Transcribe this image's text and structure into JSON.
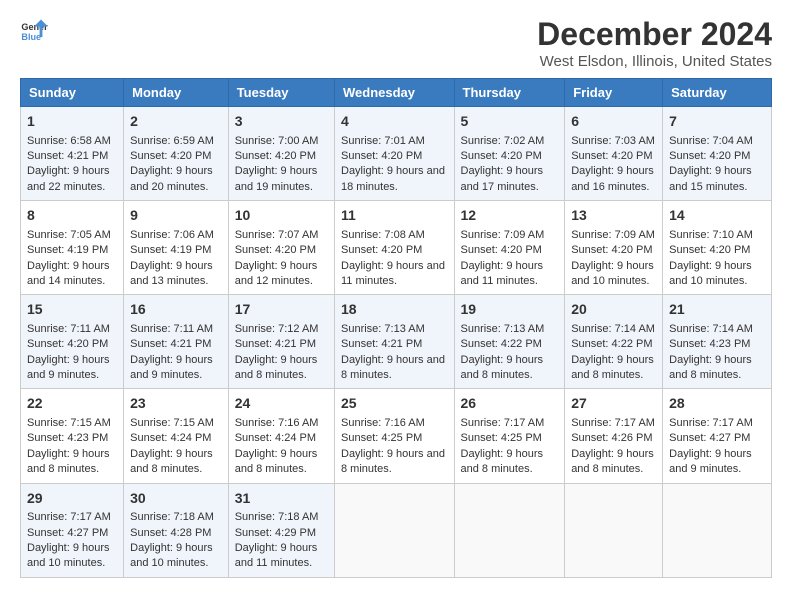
{
  "logo": {
    "line1": "General",
    "line2": "Blue"
  },
  "title": "December 2024",
  "subtitle": "West Elsdon, Illinois, United States",
  "days_of_week": [
    "Sunday",
    "Monday",
    "Tuesday",
    "Wednesday",
    "Thursday",
    "Friday",
    "Saturday"
  ],
  "weeks": [
    [
      {
        "day": "1",
        "sunrise": "6:58 AM",
        "sunset": "4:21 PM",
        "daylight": "9 hours and 22 minutes."
      },
      {
        "day": "2",
        "sunrise": "6:59 AM",
        "sunset": "4:20 PM",
        "daylight": "9 hours and 20 minutes."
      },
      {
        "day": "3",
        "sunrise": "7:00 AM",
        "sunset": "4:20 PM",
        "daylight": "9 hours and 19 minutes."
      },
      {
        "day": "4",
        "sunrise": "7:01 AM",
        "sunset": "4:20 PM",
        "daylight": "9 hours and 18 minutes."
      },
      {
        "day": "5",
        "sunrise": "7:02 AM",
        "sunset": "4:20 PM",
        "daylight": "9 hours and 17 minutes."
      },
      {
        "day": "6",
        "sunrise": "7:03 AM",
        "sunset": "4:20 PM",
        "daylight": "9 hours and 16 minutes."
      },
      {
        "day": "7",
        "sunrise": "7:04 AM",
        "sunset": "4:20 PM",
        "daylight": "9 hours and 15 minutes."
      }
    ],
    [
      {
        "day": "8",
        "sunrise": "7:05 AM",
        "sunset": "4:19 PM",
        "daylight": "9 hours and 14 minutes."
      },
      {
        "day": "9",
        "sunrise": "7:06 AM",
        "sunset": "4:19 PM",
        "daylight": "9 hours and 13 minutes."
      },
      {
        "day": "10",
        "sunrise": "7:07 AM",
        "sunset": "4:20 PM",
        "daylight": "9 hours and 12 minutes."
      },
      {
        "day": "11",
        "sunrise": "7:08 AM",
        "sunset": "4:20 PM",
        "daylight": "9 hours and 11 minutes."
      },
      {
        "day": "12",
        "sunrise": "7:09 AM",
        "sunset": "4:20 PM",
        "daylight": "9 hours and 11 minutes."
      },
      {
        "day": "13",
        "sunrise": "7:09 AM",
        "sunset": "4:20 PM",
        "daylight": "9 hours and 10 minutes."
      },
      {
        "day": "14",
        "sunrise": "7:10 AM",
        "sunset": "4:20 PM",
        "daylight": "9 hours and 10 minutes."
      }
    ],
    [
      {
        "day": "15",
        "sunrise": "7:11 AM",
        "sunset": "4:20 PM",
        "daylight": "9 hours and 9 minutes."
      },
      {
        "day": "16",
        "sunrise": "7:11 AM",
        "sunset": "4:21 PM",
        "daylight": "9 hours and 9 minutes."
      },
      {
        "day": "17",
        "sunrise": "7:12 AM",
        "sunset": "4:21 PM",
        "daylight": "9 hours and 8 minutes."
      },
      {
        "day": "18",
        "sunrise": "7:13 AM",
        "sunset": "4:21 PM",
        "daylight": "9 hours and 8 minutes."
      },
      {
        "day": "19",
        "sunrise": "7:13 AM",
        "sunset": "4:22 PM",
        "daylight": "9 hours and 8 minutes."
      },
      {
        "day": "20",
        "sunrise": "7:14 AM",
        "sunset": "4:22 PM",
        "daylight": "9 hours and 8 minutes."
      },
      {
        "day": "21",
        "sunrise": "7:14 AM",
        "sunset": "4:23 PM",
        "daylight": "9 hours and 8 minutes."
      }
    ],
    [
      {
        "day": "22",
        "sunrise": "7:15 AM",
        "sunset": "4:23 PM",
        "daylight": "9 hours and 8 minutes."
      },
      {
        "day": "23",
        "sunrise": "7:15 AM",
        "sunset": "4:24 PM",
        "daylight": "9 hours and 8 minutes."
      },
      {
        "day": "24",
        "sunrise": "7:16 AM",
        "sunset": "4:24 PM",
        "daylight": "9 hours and 8 minutes."
      },
      {
        "day": "25",
        "sunrise": "7:16 AM",
        "sunset": "4:25 PM",
        "daylight": "9 hours and 8 minutes."
      },
      {
        "day": "26",
        "sunrise": "7:17 AM",
        "sunset": "4:25 PM",
        "daylight": "9 hours and 8 minutes."
      },
      {
        "day": "27",
        "sunrise": "7:17 AM",
        "sunset": "4:26 PM",
        "daylight": "9 hours and 8 minutes."
      },
      {
        "day": "28",
        "sunrise": "7:17 AM",
        "sunset": "4:27 PM",
        "daylight": "9 hours and 9 minutes."
      }
    ],
    [
      {
        "day": "29",
        "sunrise": "7:17 AM",
        "sunset": "4:27 PM",
        "daylight": "9 hours and 10 minutes."
      },
      {
        "day": "30",
        "sunrise": "7:18 AM",
        "sunset": "4:28 PM",
        "daylight": "9 hours and 10 minutes."
      },
      {
        "day": "31",
        "sunrise": "7:18 AM",
        "sunset": "4:29 PM",
        "daylight": "9 hours and 11 minutes."
      },
      null,
      null,
      null,
      null
    ]
  ],
  "labels": {
    "sunrise": "Sunrise:",
    "sunset": "Sunset:",
    "daylight": "Daylight:"
  }
}
